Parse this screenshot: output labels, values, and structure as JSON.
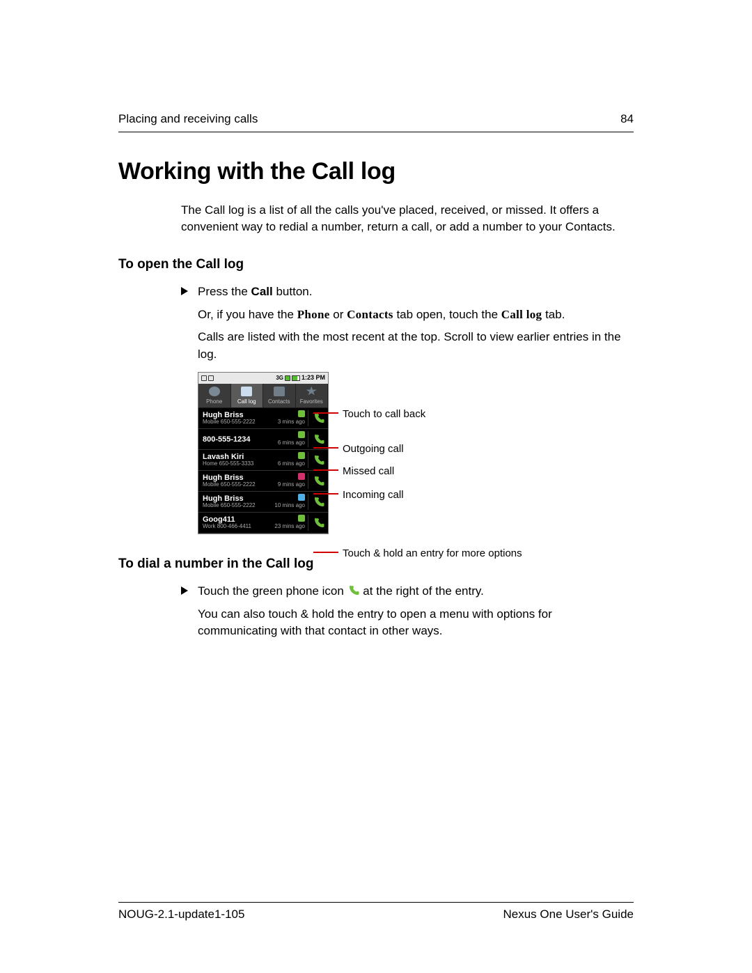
{
  "header": {
    "section": "Placing and receiving calls",
    "page_number": "84"
  },
  "title": "Working with the Call log",
  "intro": "The Call log is a list of all the calls you've placed, received, or missed. It offers a convenient way to redial a number, return a call, or add a number to your Contacts.",
  "section_open": {
    "heading": "To open the Call log",
    "step_prefix": "Press the ",
    "step_bold": "Call",
    "step_suffix": " button.",
    "line2_a": "Or, if you have the ",
    "line2_phone": "Phone",
    "line2_b": " or ",
    "line2_contacts": "Contacts",
    "line2_c": " tab open, touch the ",
    "line2_calllog": "Call log",
    "line2_d": " tab.",
    "line3": "Calls are listed with the most recent at the top. Scroll to view earlier entries in the log."
  },
  "phone": {
    "status_time": "1:23 PM",
    "status_net": "3G",
    "tabs": [
      {
        "label": "Phone"
      },
      {
        "label": "Call log"
      },
      {
        "label": "Contacts"
      },
      {
        "label": "Favorites"
      }
    ],
    "entries": [
      {
        "name": "Hugh Briss",
        "type": "Mobile",
        "number": "650-555-2222",
        "time": "3 mins ago",
        "dir": "out"
      },
      {
        "name": "800-555-1234",
        "type": "",
        "number": "",
        "time": "6 mins ago",
        "dir": "out"
      },
      {
        "name": "Lavash Kiri",
        "type": "Home",
        "number": "650-555-3333",
        "time": "6 mins ago",
        "dir": "out"
      },
      {
        "name": "Hugh Briss",
        "type": "Mobile",
        "number": "650-555-2222",
        "time": "9 mins ago",
        "dir": "miss"
      },
      {
        "name": "Hugh Briss",
        "type": "Mobile",
        "number": "650-555-2222",
        "time": "10 mins ago",
        "dir": "in"
      },
      {
        "name": "Goog411",
        "type": "Work",
        "number": "800-466-4411",
        "time": "23 mins ago",
        "dir": "out"
      }
    ]
  },
  "callouts": {
    "c1": "Touch to call back",
    "c2": "Outgoing call",
    "c3": "Missed call",
    "c4": "Incoming call",
    "c5": "Touch & hold an entry for more options"
  },
  "section_dial": {
    "heading": "To dial a number in the Call log",
    "step_a": "Touch the green phone icon ",
    "step_b": " at the right of the entry.",
    "line2": "You can also touch & hold the entry to open a menu with options for communicating with that contact in other ways."
  },
  "footer": {
    "doc_id": "NOUG-2.1-update1-105",
    "guide": "Nexus One User's Guide"
  }
}
